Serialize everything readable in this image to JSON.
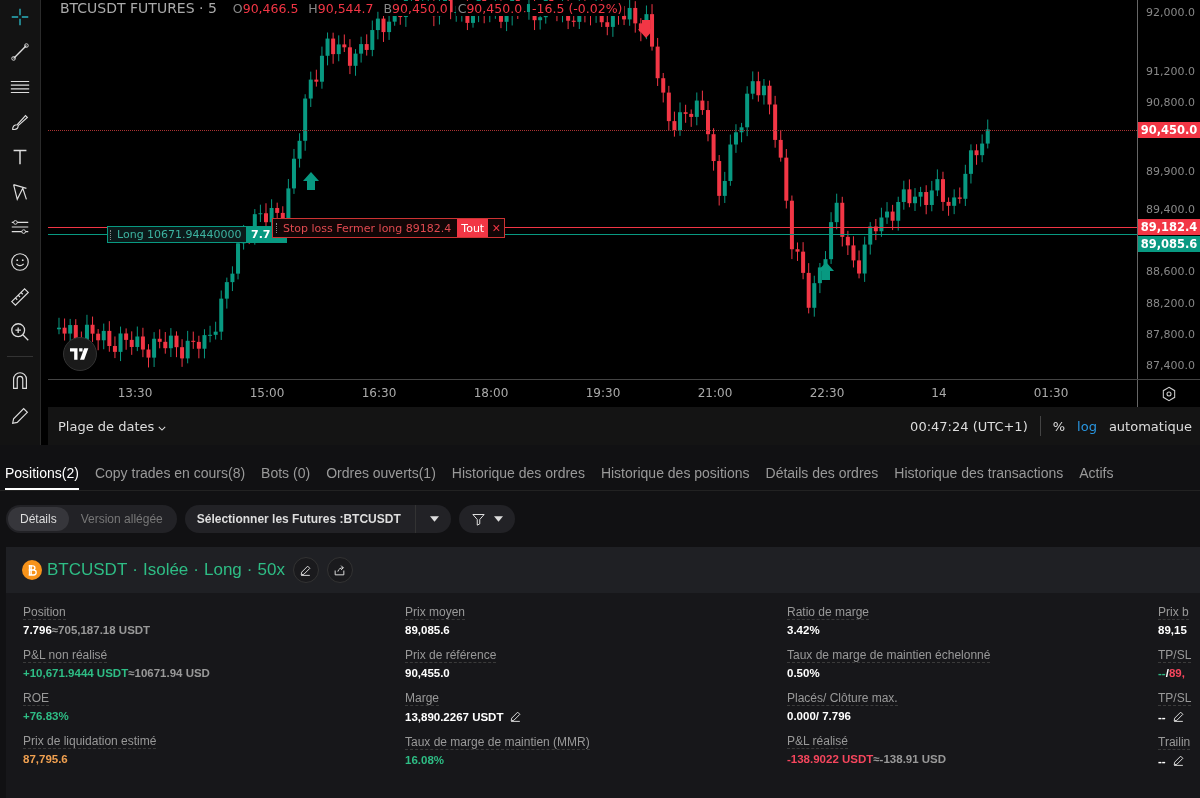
{
  "chart": {
    "symbol": "BTCUSDT FUTURES · 5",
    "ohlc": [
      {
        "label": "O",
        "value": "90,466.5"
      },
      {
        "label": "H",
        "value": "90,544.7"
      },
      {
        "label": "B",
        "value": "90,450.0"
      },
      {
        "label": "C",
        "value": "90,450.0"
      }
    ],
    "change": "-16.5 (-0.02%)",
    "price_ticks": [
      "92,000.0",
      "91,200.0",
      "90,800.0",
      "89,900.0",
      "89,400.0",
      "88,600.0",
      "88,200.0",
      "87,800.0",
      "87,400.0"
    ],
    "price_badges": [
      {
        "text": "90,450.0",
        "color": "#f23645"
      },
      {
        "text": "89,182.4",
        "color": "#f23645"
      },
      {
        "text": "89,085.6",
        "color": "#089981"
      }
    ],
    "time_ticks": [
      "13:30",
      "15:00",
      "16:30",
      "18:00",
      "19:30",
      "21:00",
      "22:30",
      "14",
      "01:30"
    ],
    "position_label": {
      "text": "Long 10671.94440000",
      "qty": "7.7"
    },
    "stop_label": {
      "text": "Stop loss Fermer long 89182.4",
      "action": "Tout",
      "close": "×"
    }
  },
  "bottom_bar": {
    "range": "Plage de dates",
    "time": "00:47:24 (UTC+1)",
    "percent": "%",
    "log": "log",
    "auto": "automatique"
  },
  "tabs": [
    {
      "label": "Positions(2)",
      "selected": true
    },
    {
      "label": "Copy trades en cours(8)",
      "selected": false
    },
    {
      "label": "Bots (0)",
      "selected": false
    },
    {
      "label": "Ordres ouverts(1)",
      "selected": false
    },
    {
      "label": "Historique des ordres",
      "selected": false
    },
    {
      "label": "Historique des positions",
      "selected": false
    },
    {
      "label": "Détails des ordres",
      "selected": false
    },
    {
      "label": "Historique des transactions",
      "selected": false
    },
    {
      "label": "Actifs",
      "selected": false
    }
  ],
  "views": [
    {
      "label": "Détails",
      "selected": true
    },
    {
      "label": "Version allégée",
      "selected": false
    }
  ],
  "futures_select": "Sélectionner les Futures :BTCUSDT",
  "position": {
    "title": [
      "BTCUSDT",
      "·",
      "Isolée",
      "·",
      "Long",
      "·",
      "50x"
    ],
    "columns": [
      [
        {
          "label": "Position",
          "parts": [
            {
              "text": "7.796",
              "color": "#ffffff"
            },
            {
              "text": "≈705,187.18 USDT",
              "color": "#999999"
            }
          ],
          "editable": false
        },
        {
          "label": "P&L non réalisé",
          "parts": [
            {
              "text": "+10,671.9444 USDT",
              "color": "#2ebd85"
            },
            {
              "text": "≈10671.94 USD",
              "color": "#999999"
            }
          ],
          "editable": false
        },
        {
          "label": "ROE",
          "parts": [
            {
              "text": "+76.83%",
              "color": "#2ebd85"
            }
          ],
          "editable": false
        },
        {
          "label": "Prix de liquidation estimé",
          "parts": [
            {
              "text": "87,795.6",
              "color": "#f0a050"
            }
          ],
          "editable": false
        }
      ],
      [
        {
          "label": "Prix moyen",
          "parts": [
            {
              "text": "89,085.6",
              "color": "#ffffff"
            }
          ],
          "editable": false
        },
        {
          "label": "Prix de référence",
          "parts": [
            {
              "text": "90,455.0",
              "color": "#ffffff"
            }
          ],
          "editable": false
        },
        {
          "label": "Marge",
          "parts": [
            {
              "text": "13,890.2267 USDT",
              "color": "#ffffff"
            }
          ],
          "editable": true
        },
        {
          "label": "Taux de marge de maintien (MMR)",
          "parts": [
            {
              "text": "16.08%",
              "color": "#2ebd85"
            }
          ],
          "editable": false
        }
      ],
      [
        {
          "label": "Ratio de marge",
          "parts": [
            {
              "text": "3.42%",
              "color": "#ffffff"
            }
          ],
          "editable": false
        },
        {
          "label": "Taux de marge de maintien échelonné",
          "parts": [
            {
              "text": "0.50%",
              "color": "#ffffff"
            }
          ],
          "editable": false
        },
        {
          "label": "Placés/ Clôture max.",
          "parts": [
            {
              "text": "0.000/ 7.796",
              "color": "#ffffff"
            }
          ],
          "editable": false
        },
        {
          "label": "P&L réalisé",
          "parts": [
            {
              "text": "-138.9022 USDT",
              "color": "#f6465d"
            },
            {
              "text": "≈-138.91 USD",
              "color": "#999999"
            }
          ],
          "editable": false
        }
      ],
      [
        {
          "label": "Prix b",
          "parts": [
            {
              "text": "89,15",
              "color": "#ffffff"
            }
          ],
          "editable": false
        },
        {
          "label": "TP/SL",
          "parts": [
            {
              "text": "--",
              "color": "#2ebd85"
            },
            {
              "text": "/",
              "color": "#ffffff"
            },
            {
              "text": "89,",
              "color": "#f6465d"
            }
          ],
          "editable": false
        },
        {
          "label": "TP/SL",
          "parts": [
            {
              "text": "--",
              "color": "#ffffff"
            }
          ],
          "editable": true
        },
        {
          "label": "Trailin",
          "parts": [
            {
              "text": "--",
              "color": "#ffffff"
            }
          ],
          "editable": true
        }
      ]
    ]
  }
}
